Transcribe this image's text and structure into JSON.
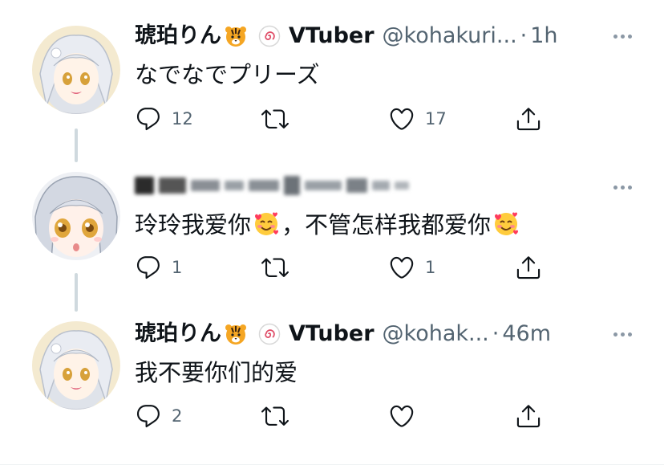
{
  "tweets": [
    {
      "author_name": "琥珀りん",
      "author_badge_label": "VTuber",
      "handle": "@kohakuri...",
      "dot": "·",
      "time": "1h",
      "text": "なでなでプリーズ",
      "replies": "12",
      "retweets": "",
      "likes": "17",
      "avatar": "anime-silver-hair-girl"
    },
    {
      "author_name": "",
      "handle": "",
      "time": "",
      "text_part1": "玲玲我爱你",
      "text_part2": "，不管怎样我都爱你",
      "emoji": "smiling-face-with-hearts",
      "replies": "1",
      "retweets": "",
      "likes": "1",
      "avatar": "anime-silver-hair-surprised"
    },
    {
      "author_name": "琥珀りん",
      "author_badge_label": "VTuber",
      "handle": "@kohak...",
      "dot": "·",
      "time": "46m",
      "text": "我不要你们的爱",
      "replies": "2",
      "retweets": "",
      "likes": "",
      "avatar": "anime-silver-hair-girl"
    }
  ],
  "icons": {
    "reply": "reply-icon",
    "retweet": "retweet-icon",
    "like": "heart-icon",
    "share": "share-icon",
    "more": "more-dots-icon",
    "tiger": "tiger-emoji-icon",
    "badge": "swirl-badge-icon"
  },
  "colors": {
    "text": "#0f1419",
    "muted": "#536471",
    "thread_line": "#cfd9de"
  }
}
